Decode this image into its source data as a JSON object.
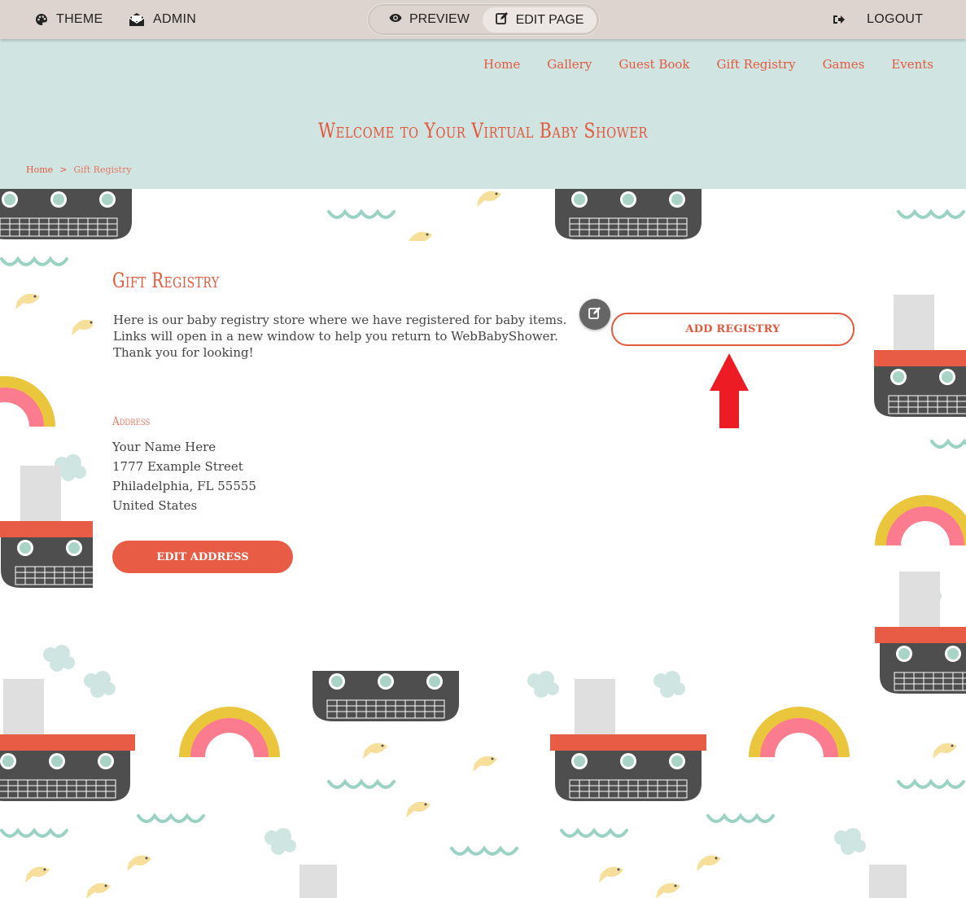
{
  "adminbar": {
    "theme_label": "THEME",
    "admin_label": "ADMIN",
    "preview_label": "PREVIEW",
    "edit_page_label": "EDIT PAGE",
    "logout_label": "LOGOUT"
  },
  "nav": {
    "items": [
      "Home",
      "Gallery",
      "Guest Book",
      "Gift Registry",
      "Games",
      "Events"
    ]
  },
  "header": {
    "site_title": "Welcome to Your Virtual Baby Shower"
  },
  "breadcrumb": {
    "home": "Home",
    "separator": ">",
    "current": "Gift Registry"
  },
  "registry": {
    "heading": "Gift Registry",
    "intro": "Here is our baby registry store where we have registered for baby items. Links will open in a new window to help you return to WebBabyShower. Thank you for looking!",
    "add_button": "ADD REGISTRY"
  },
  "address": {
    "label": "Address",
    "lines": [
      "Your Name Here",
      "1777 Example Street",
      "Philadelphia, FL 55555",
      "United States"
    ],
    "edit_button": "EDIT ADDRESS"
  },
  "colors": {
    "accent": "#e4593e",
    "header_bg": "#d0e4e1",
    "adminbar_bg": "#ddd4cf",
    "arrow": "#ed1c24"
  },
  "icons": {
    "theme": "palette-icon",
    "admin": "envelope-open-icon",
    "preview": "eye-icon",
    "edit_page": "edit-icon",
    "logout": "sign-out-icon",
    "fab": "edit-icon"
  }
}
